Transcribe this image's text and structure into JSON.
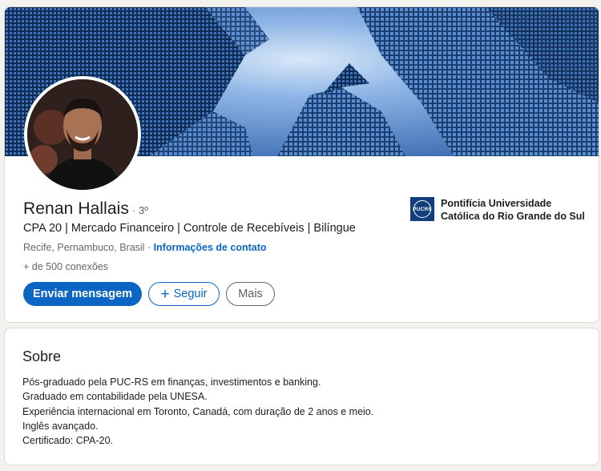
{
  "profile": {
    "name": "Renan Hallais",
    "degree": "· 3º",
    "headline": "CPA 20 | Mercado Financeiro | Controle de Recebíveis | Bilíngue",
    "location": "Recife, Pernambuco, Brasil",
    "location_separator": " · ",
    "contact_link": "Informações de contato",
    "connections": "+ de 500 conexões",
    "cover_image": "building-skyscrapers-image",
    "avatar_image": "profile-photo"
  },
  "actions": {
    "message_label": "Enviar mensagem",
    "follow_icon": "+",
    "follow_label": "Seguir",
    "more_label": "Mais"
  },
  "education": {
    "logo_text": "PUCRS",
    "school_name": "Pontifícia Universidade Católica do Rio Grande do Sul"
  },
  "about": {
    "title": "Sobre",
    "lines": [
      "Pós-graduado pela PUC-RS em finanças, investimentos e banking.",
      "Graduado em contabilidade pela UNESA.",
      "Experiência internacional em Toronto, Canadá, com duração de 2 anos e meio.",
      "Inglês avançado.",
      "Certificado: CPA-20."
    ]
  },
  "colors": {
    "primary": "#0a66c2",
    "background": "#f4f2ee",
    "school_logo": "#123e7a"
  }
}
